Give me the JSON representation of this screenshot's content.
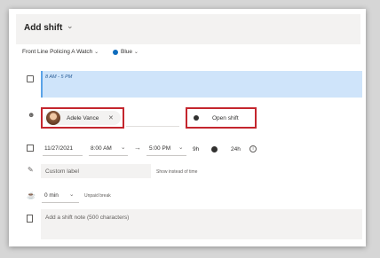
{
  "dialog": {
    "title": "Add shift",
    "title_chevron": "⌄"
  },
  "team": {
    "name": "Front Line Policing A Watch",
    "group_label": "Blue",
    "group_color": "#0f6cbd",
    "chevron": "⌄"
  },
  "time_bar": {
    "label": "8 AM - 5 PM",
    "color": "#cfe4fa"
  },
  "assignee": {
    "name": "Adele Vance",
    "remove_glyph": "✕"
  },
  "open_shift": {
    "label": "Open shift"
  },
  "schedule": {
    "start_date": "11/27/2021",
    "start_time": "8:00 AM",
    "arrow": "→",
    "end_time": "5:00 PM",
    "duration": "9h",
    "all_day_label": "24h",
    "info_glyph": "i",
    "dropdown_glyph": "⌄"
  },
  "label_field": {
    "placeholder": "Custom label",
    "hint": "Show instead of time"
  },
  "break_field": {
    "value": "0 min",
    "hint": "Unpaid break"
  },
  "note_field": {
    "placeholder": "Add a shift note (500 characters)"
  },
  "icons": {
    "clock": "clock-icon",
    "person": "person-icon",
    "calendar": "calendar-icon",
    "pencil": "pencil-icon",
    "cup": "cup-icon",
    "note": "note-icon"
  },
  "colors": {
    "highlight": "#c4262e",
    "accent": "#5aa3e8"
  }
}
